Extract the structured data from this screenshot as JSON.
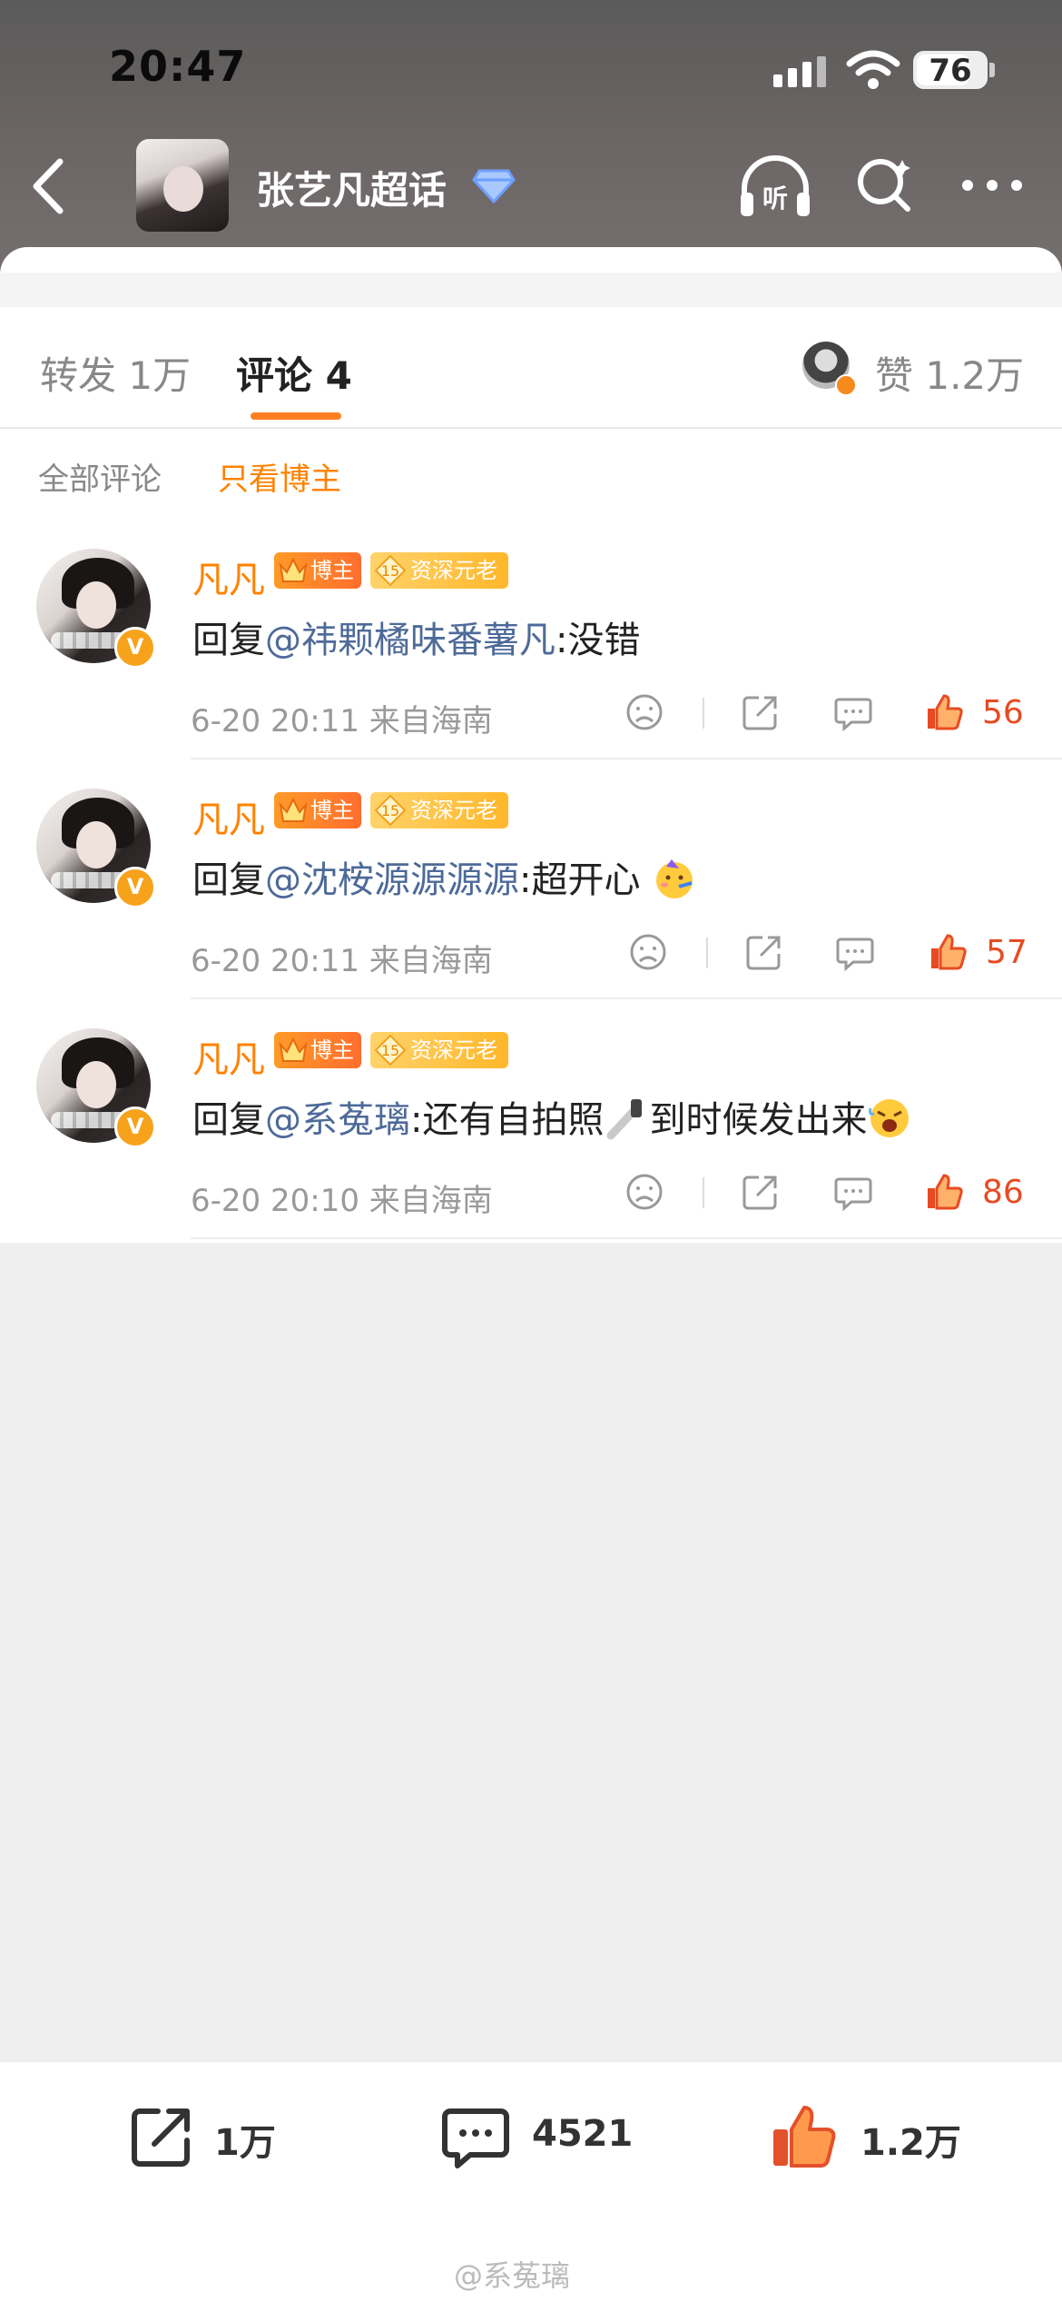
{
  "status_bar": {
    "time": "20:47",
    "battery": "76"
  },
  "header": {
    "title": "张艺凡超话"
  },
  "tabs": {
    "repost": "转发 1万",
    "comment": "评论 4",
    "likes": "赞 1.2万"
  },
  "filters": {
    "all": "全部评论",
    "blogger_only": "只看博主"
  },
  "comments": [
    {
      "name": "凡凡",
      "badge_blogger": "博主",
      "badge_senior": "资深元老",
      "reply_prefix": "回复",
      "mention": "@祎颗橘味番薯凡",
      "text": ":没错",
      "meta": "6-20 20:11 来自海南",
      "likes": "56"
    },
    {
      "name": "凡凡",
      "badge_blogger": "博主",
      "badge_senior": "资深元老",
      "reply_prefix": "回复",
      "mention": "@沈桉源源源源",
      "text": ":超开心",
      "meta": "6-20 20:11 来自海南",
      "likes": "57"
    },
    {
      "name": "凡凡",
      "badge_blogger": "博主",
      "badge_senior": "资深元老",
      "reply_prefix": "回复",
      "mention": "@系菟璃",
      "text": ":还有自拍照",
      "text_after": "到时候发出来",
      "meta": "6-20 20:10 来自海南",
      "likes": "86"
    }
  ],
  "bottom_bar": {
    "share": "1万",
    "comment": "4521",
    "like": "1.2万"
  },
  "watermark": "@系菟璃",
  "colors": {
    "accent": "#ff8200",
    "mention": "#4d6a99",
    "like": "#e74b22"
  }
}
